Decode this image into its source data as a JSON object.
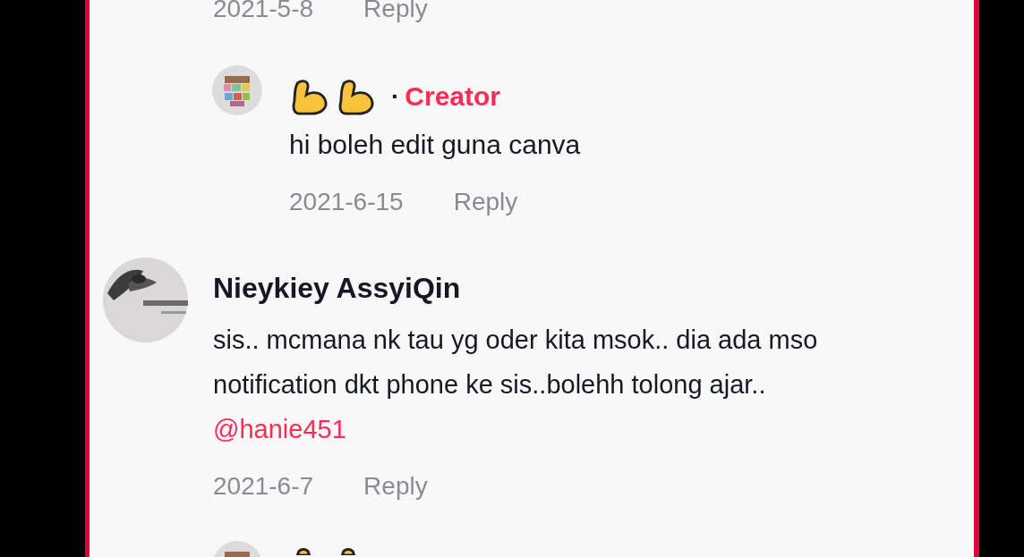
{
  "top_footer": {
    "date": "2021-5-8",
    "action": "Reply"
  },
  "thread": [
    {
      "kind": "reply",
      "separator": "·",
      "creator_label": "Creator",
      "text": "hi boleh edit guna canva",
      "date": "2021-6-15",
      "action": "Reply"
    },
    {
      "kind": "comment",
      "author": "Nieykiey AssyiQin",
      "lines": [
        "sis.. mcmana nk tau yg oder kita msok.. dia ada mso",
        "notification dkt phone ke sis..bolehh tolong ajar.."
      ],
      "mention": "@hanie451",
      "date": "2021-6-7",
      "action": "Reply"
    },
    {
      "kind": "reply_partial"
    }
  ]
}
